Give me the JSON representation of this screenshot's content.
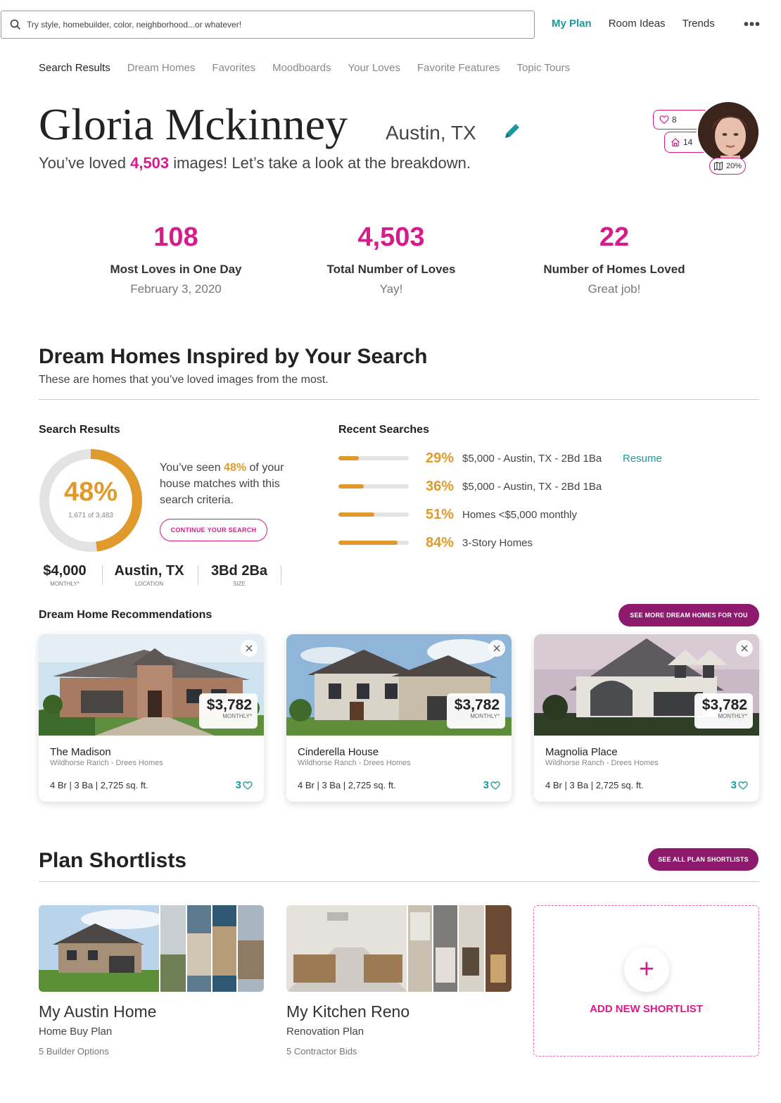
{
  "search": {
    "placeholder": "Try style, homebuilder, color, neighborhood...or whatever!"
  },
  "topnav": {
    "items": [
      "My Plan",
      "Room Ideas",
      "Trends"
    ],
    "more": "•••"
  },
  "tabs": [
    "Search Results",
    "Dream Homes",
    "Favorites",
    "Moodboards",
    "Your Loves",
    "Favorite Features",
    "Topic Tours"
  ],
  "profile": {
    "name": "Gloria Mckinney",
    "location": "Austin, TX",
    "loved_prefix": "You’ve loved ",
    "loved_count": "4,503",
    "loved_suffix": " images! Let’s take a look at the breakdown.",
    "badge_loves": "8",
    "badge_homes": "14",
    "badge_plan": "20%"
  },
  "stats": [
    {
      "num": "108",
      "label": "Most Loves in One Day",
      "sub": "February 3, 2020"
    },
    {
      "num": "4,503",
      "label": "Total Number of Loves",
      "sub": "Yay!"
    },
    {
      "num": "22",
      "label": "Number of Homes Loved",
      "sub": "Great job!"
    }
  ],
  "dream_section": {
    "title": "Dream Homes Inspired by Your Search",
    "subtitle": "These are homes that you’ve loved images from the most."
  },
  "search_results": {
    "title": "Search Results",
    "percent": "48%",
    "percent_value": 0.48,
    "count": "1,671 of 3,483",
    "seen_prefix": "You’ve seen ",
    "seen_pct": "48%",
    "seen_suffix": " of your house matches with this search criteria.",
    "button": "CONTINUE YOUR SEARCH",
    "criteria": [
      {
        "value": "$4,000",
        "key": "MONTHLY*"
      },
      {
        "value": "Austin, TX",
        "key": "LOCATION"
      },
      {
        "value": "3Bd 2Ba",
        "key": "SIZE"
      }
    ]
  },
  "recent_searches": {
    "title": "Recent Searches",
    "resume": "Resume",
    "items": [
      {
        "pct": "29%",
        "fill": 0.29,
        "label": "$5,000 - Austin, TX - 2Bd 1Ba"
      },
      {
        "pct": "36%",
        "fill": 0.36,
        "label": "$5,000 - Austin, TX - 2Bd 1Ba"
      },
      {
        "pct": "51%",
        "fill": 0.51,
        "label": "Homes <$5,000 monthly"
      },
      {
        "pct": "84%",
        "fill": 0.84,
        "label": "3-Story Homes"
      }
    ]
  },
  "recommendations": {
    "title": "Dream Home Recommendations",
    "button": "SEE MORE DREAM HOMES FOR YOU",
    "cards": [
      {
        "name": "The Madison",
        "community": "Wildhorse Ranch - Drees Homes",
        "price": "$3,782",
        "monthly": "MONTHLY*",
        "specs": "4 Br | 3 Ba | 2,725 sq. ft.",
        "loves": "3"
      },
      {
        "name": "Cinderella House",
        "community": "Wildhorse Ranch - Drees Homes",
        "price": "$3,782",
        "monthly": "MONTHLY*",
        "specs": "4 Br | 3 Ba | 2,725 sq. ft.",
        "loves": "3"
      },
      {
        "name": "Magnolia Place",
        "community": "Wildhorse Ranch - Drees Homes",
        "price": "$3,782",
        "monthly": "MONTHLY*",
        "specs": "4 Br | 3 Ba | 2,725 sq. ft.",
        "loves": "3"
      }
    ]
  },
  "shortlists": {
    "title": "Plan Shortlists",
    "button": "SEE ALL PLAN SHORTLISTS",
    "items": [
      {
        "title": "My Austin Home",
        "type": "Home Buy Plan",
        "count": "5 Builder Options"
      },
      {
        "title": "My Kitchen Reno",
        "type": "Renovation Plan",
        "count": "5 Contractor Bids"
      }
    ],
    "add_label": "ADD NEW SHORTLIST",
    "add_icon": "+"
  },
  "colors": {
    "accent_pink": "#d81b8a",
    "accent_teal": "#1a9aa0",
    "accent_orange": "#e09a2c",
    "accent_purple": "#8d1a6d"
  }
}
